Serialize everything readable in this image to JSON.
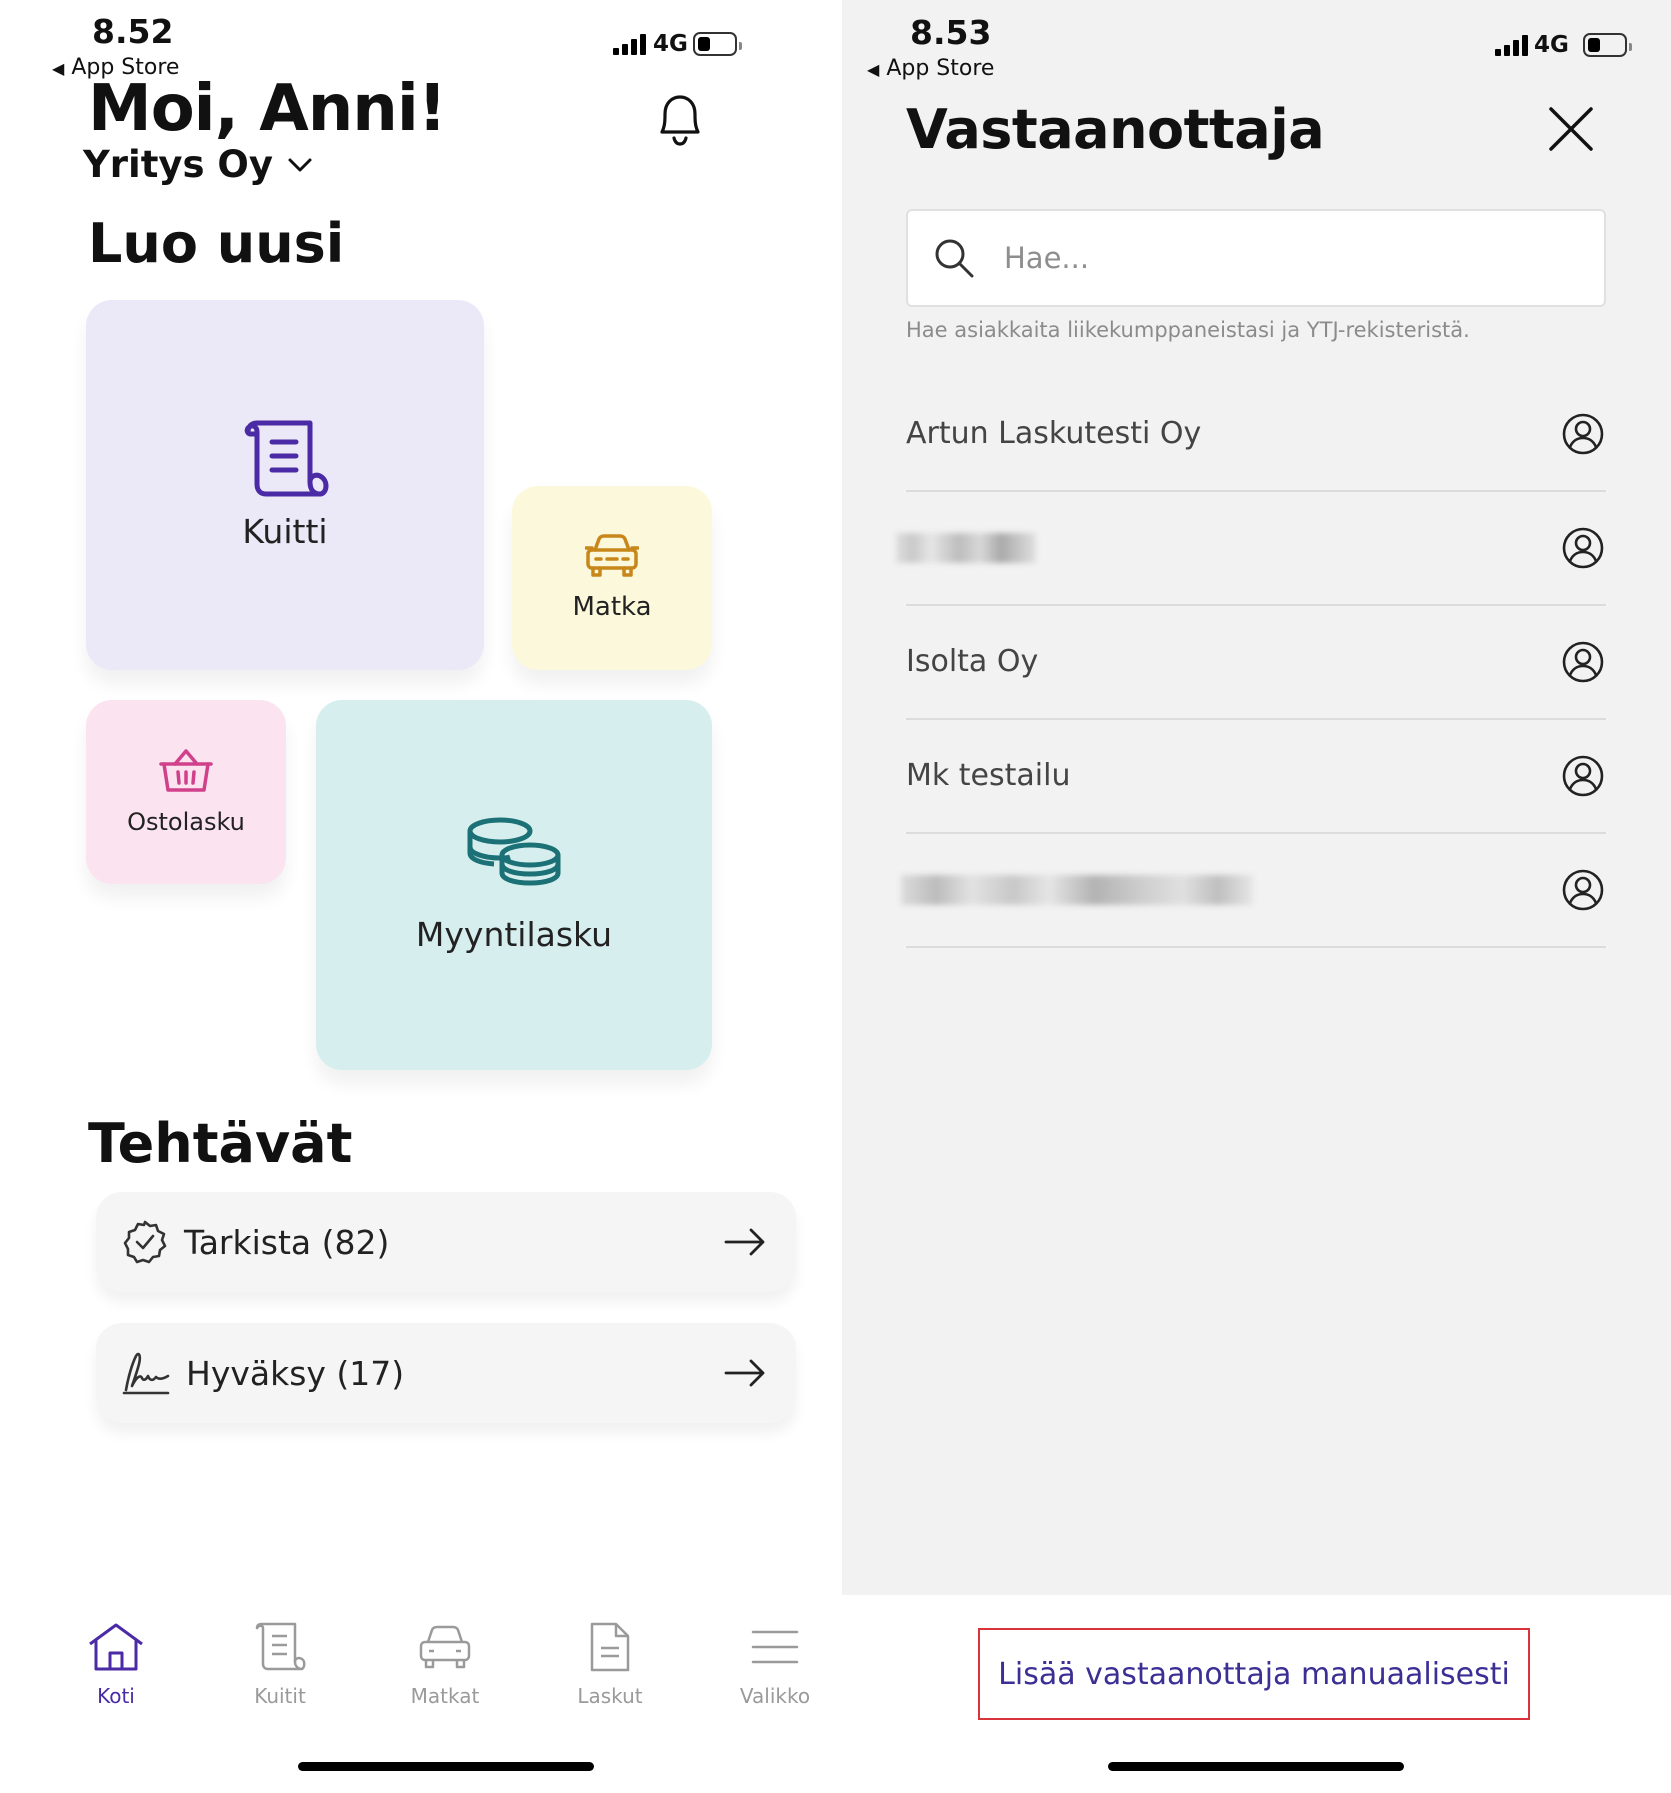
{
  "left": {
    "status": {
      "time": "8.52",
      "back_label": "App Store",
      "network": "4G"
    },
    "greeting": "Moi, Anni!",
    "company": "Yritys Oy",
    "create_heading": "Luo uusi",
    "tiles": {
      "kuitti": "Kuitti",
      "matka": "Matka",
      "ostolasku": "Ostolasku",
      "myyntilasku": "Myyntilasku"
    },
    "tasks_heading": "Tehtävät",
    "tasks": [
      {
        "label": "Tarkista (82)"
      },
      {
        "label": "Hyväksy (17)"
      }
    ],
    "nav": [
      {
        "label": "Koti",
        "active": true
      },
      {
        "label": "Kuitit"
      },
      {
        "label": "Matkat"
      },
      {
        "label": "Laskut"
      },
      {
        "label": "Valikko"
      }
    ]
  },
  "right": {
    "status": {
      "time": "8.53",
      "back_label": "App Store",
      "network": "4G"
    },
    "title": "Vastaanottaja",
    "search": {
      "placeholder": "Hae...",
      "hint": "Hae asiakkaita liikekumppaneistasi ja YTJ-rekisteristä."
    },
    "recipients": [
      {
        "name": "Artun Laskutesti Oy"
      },
      {
        "name": "",
        "redacted": true
      },
      {
        "name": "Isolta Oy"
      },
      {
        "name": "Mk testailu"
      },
      {
        "name": "",
        "redacted": true
      }
    ],
    "add_manual_label": "Lisää vastaanottaja manuaalisesti"
  },
  "colors": {
    "accent_purple": "#4b2aa6",
    "kuitti_bg": "#ebe8f7",
    "matka_bg": "#fcf8dc",
    "matka_icon": "#c8871a",
    "ostolasku_bg": "#fbe4f0",
    "ostolasku_icon": "#d0408b",
    "myyntilasku_bg": "#d6efee",
    "myyntilasku_icon": "#1b7176",
    "nav_inactive": "#9a9a9a",
    "button_border": "#d9343b",
    "button_text": "#3b2f96"
  }
}
